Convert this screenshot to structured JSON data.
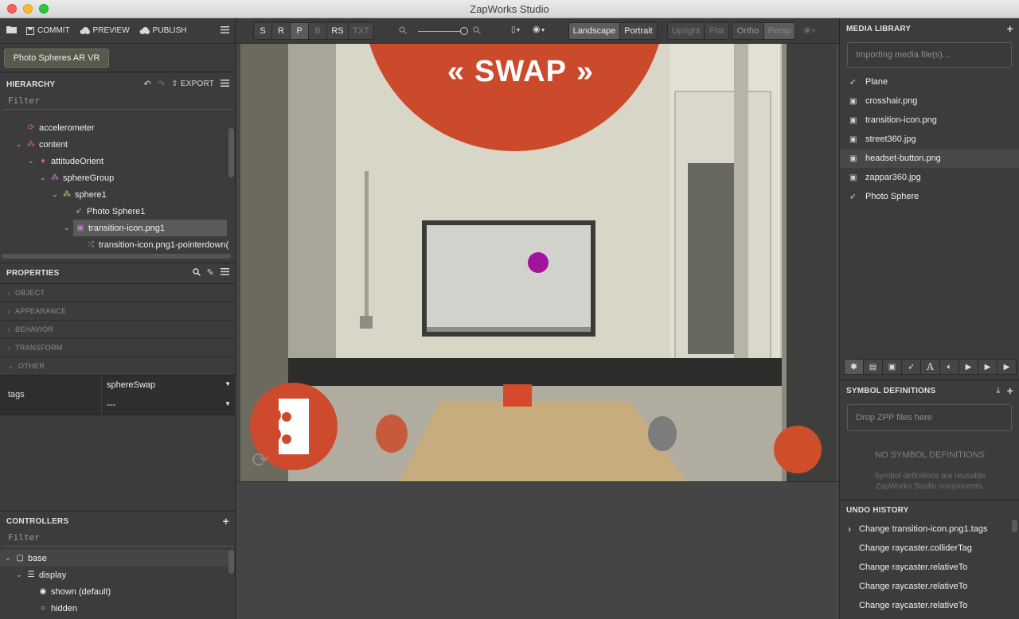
{
  "window": {
    "title": "ZapWorks Studio"
  },
  "toolbar_left": {
    "commit": "COMMIT",
    "preview": "PREVIEW",
    "publish": "PUBLISH"
  },
  "project_button": "Photo Spheres AR VR",
  "hierarchy": {
    "title": "HIERARCHY",
    "export": "EXPORT",
    "filter_placeholder": "Filter",
    "items": [
      {
        "label": "accelerometer",
        "icon": "sync-icon"
      },
      {
        "label": "content",
        "icon": "group-icon"
      },
      {
        "label": "attitudeOrient",
        "icon": "globe-icon"
      },
      {
        "label": "sphereGroup",
        "icon": "group-icon"
      },
      {
        "label": "sphere1",
        "icon": "group-icon"
      },
      {
        "label": "Photo Sphere1",
        "icon": "rocket-icon"
      },
      {
        "label": "transition-icon.png1",
        "icon": "image-icon",
        "selected": true
      },
      {
        "label": "transition-icon.png1-pointerdown(",
        "icon": "shuffle-icon"
      }
    ]
  },
  "properties": {
    "title": "PROPERTIES",
    "sections": [
      "OBJECT",
      "APPEARANCE",
      "BEHAVIOR",
      "TRANSFORM",
      "OTHER"
    ],
    "tags_label": "tags",
    "tags_values": [
      "sphereSwap",
      "---"
    ]
  },
  "controllers": {
    "title": "CONTROLLERS",
    "filter_placeholder": "Filter",
    "items": [
      {
        "label": "base"
      },
      {
        "label": "display"
      },
      {
        "label": "shown (default)"
      },
      {
        "label": "hidden"
      }
    ]
  },
  "view_toolbar": {
    "modes": [
      "S",
      "R",
      "P",
      "B",
      "RS",
      "TXT"
    ],
    "orientation": [
      "Landscape",
      "Portrait"
    ],
    "camera_a": [
      "Upright",
      "Flat"
    ],
    "camera_b": [
      "Ortho",
      "Persp"
    ]
  },
  "viewport": {
    "swap_label": "SWAP"
  },
  "media_library": {
    "title": "MEDIA LIBRARY",
    "import_placeholder": "Importing media file(s)...",
    "items": [
      {
        "label": "Plane",
        "icon": "rocket-icon"
      },
      {
        "label": "crosshair.png",
        "icon": "image-icon"
      },
      {
        "label": "transition-icon.png",
        "icon": "image-icon"
      },
      {
        "label": "street360.jpg",
        "icon": "image-icon"
      },
      {
        "label": "headset-button.png",
        "icon": "image-icon",
        "hover": true
      },
      {
        "label": "zappar360.jpg",
        "icon": "image-icon"
      },
      {
        "label": "Photo Sphere",
        "icon": "rocket-icon"
      }
    ]
  },
  "symbol_definitions": {
    "title": "SYMBOL DEFINITIONS",
    "drop_placeholder": "Drop ZPP files here",
    "empty_title": "NO SYMBOL DEFINITIONS",
    "empty_sub": "Symbol definitions are reusable ZapWorks Studio components."
  },
  "undo_history": {
    "title": "UNDO HISTORY",
    "items": [
      "Change transition-icon.png1.tags",
      "Change raycaster.colliderTag",
      "Change raycaster.relativeTo",
      "Change raycaster.relativeTo",
      "Change raycaster.relativeTo"
    ]
  }
}
